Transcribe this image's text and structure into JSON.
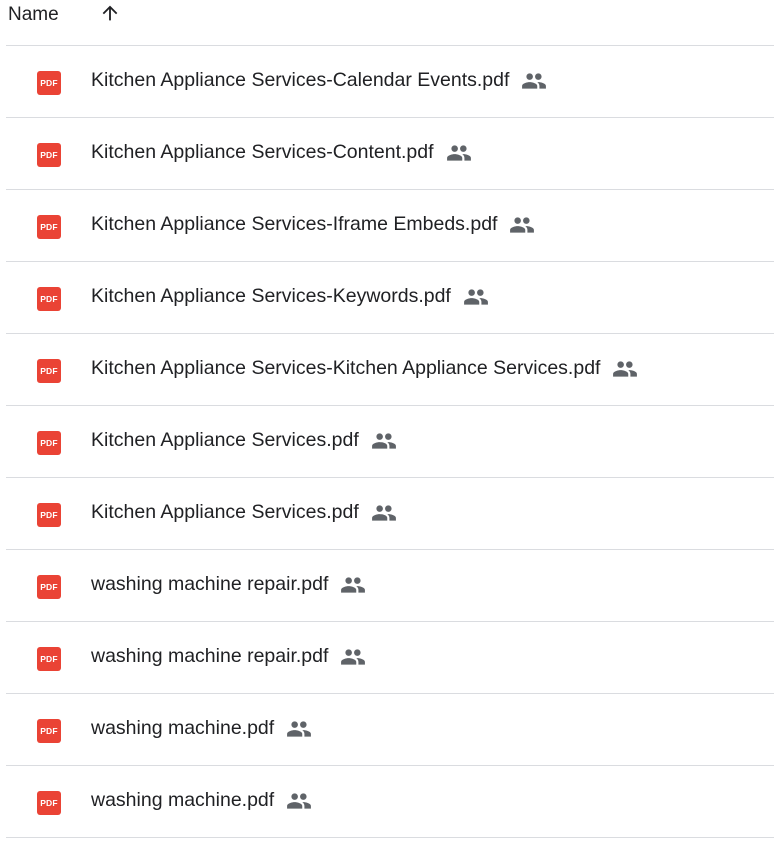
{
  "header": {
    "name_label": "Name",
    "sort_icon": "arrow-up-icon"
  },
  "file_type_badge": "PDF",
  "files": [
    {
      "name": "Kitchen Appliance Services-Calendar Events.pdf",
      "type": "pdf",
      "shared": true
    },
    {
      "name": "Kitchen Appliance Services-Content.pdf",
      "type": "pdf",
      "shared": true
    },
    {
      "name": "Kitchen Appliance Services-Iframe Embeds.pdf",
      "type": "pdf",
      "shared": true
    },
    {
      "name": "Kitchen Appliance Services-Keywords.pdf",
      "type": "pdf",
      "shared": true
    },
    {
      "name": "Kitchen Appliance Services-Kitchen Appliance Services.pdf",
      "type": "pdf",
      "shared": true
    },
    {
      "name": "Kitchen Appliance Services.pdf",
      "type": "pdf",
      "shared": true
    },
    {
      "name": "Kitchen Appliance Services.pdf",
      "type": "pdf",
      "shared": true
    },
    {
      "name": "washing machine repair.pdf",
      "type": "pdf",
      "shared": true
    },
    {
      "name": "washing machine repair.pdf",
      "type": "pdf",
      "shared": true
    },
    {
      "name": "washing machine.pdf",
      "type": "pdf",
      "shared": true
    },
    {
      "name": "washing machine.pdf",
      "type": "pdf",
      "shared": true
    }
  ],
  "colors": {
    "pdf_red": "#ea4335",
    "text": "#202124",
    "icon_gray": "#5f6368",
    "divider": "#dadce0"
  }
}
